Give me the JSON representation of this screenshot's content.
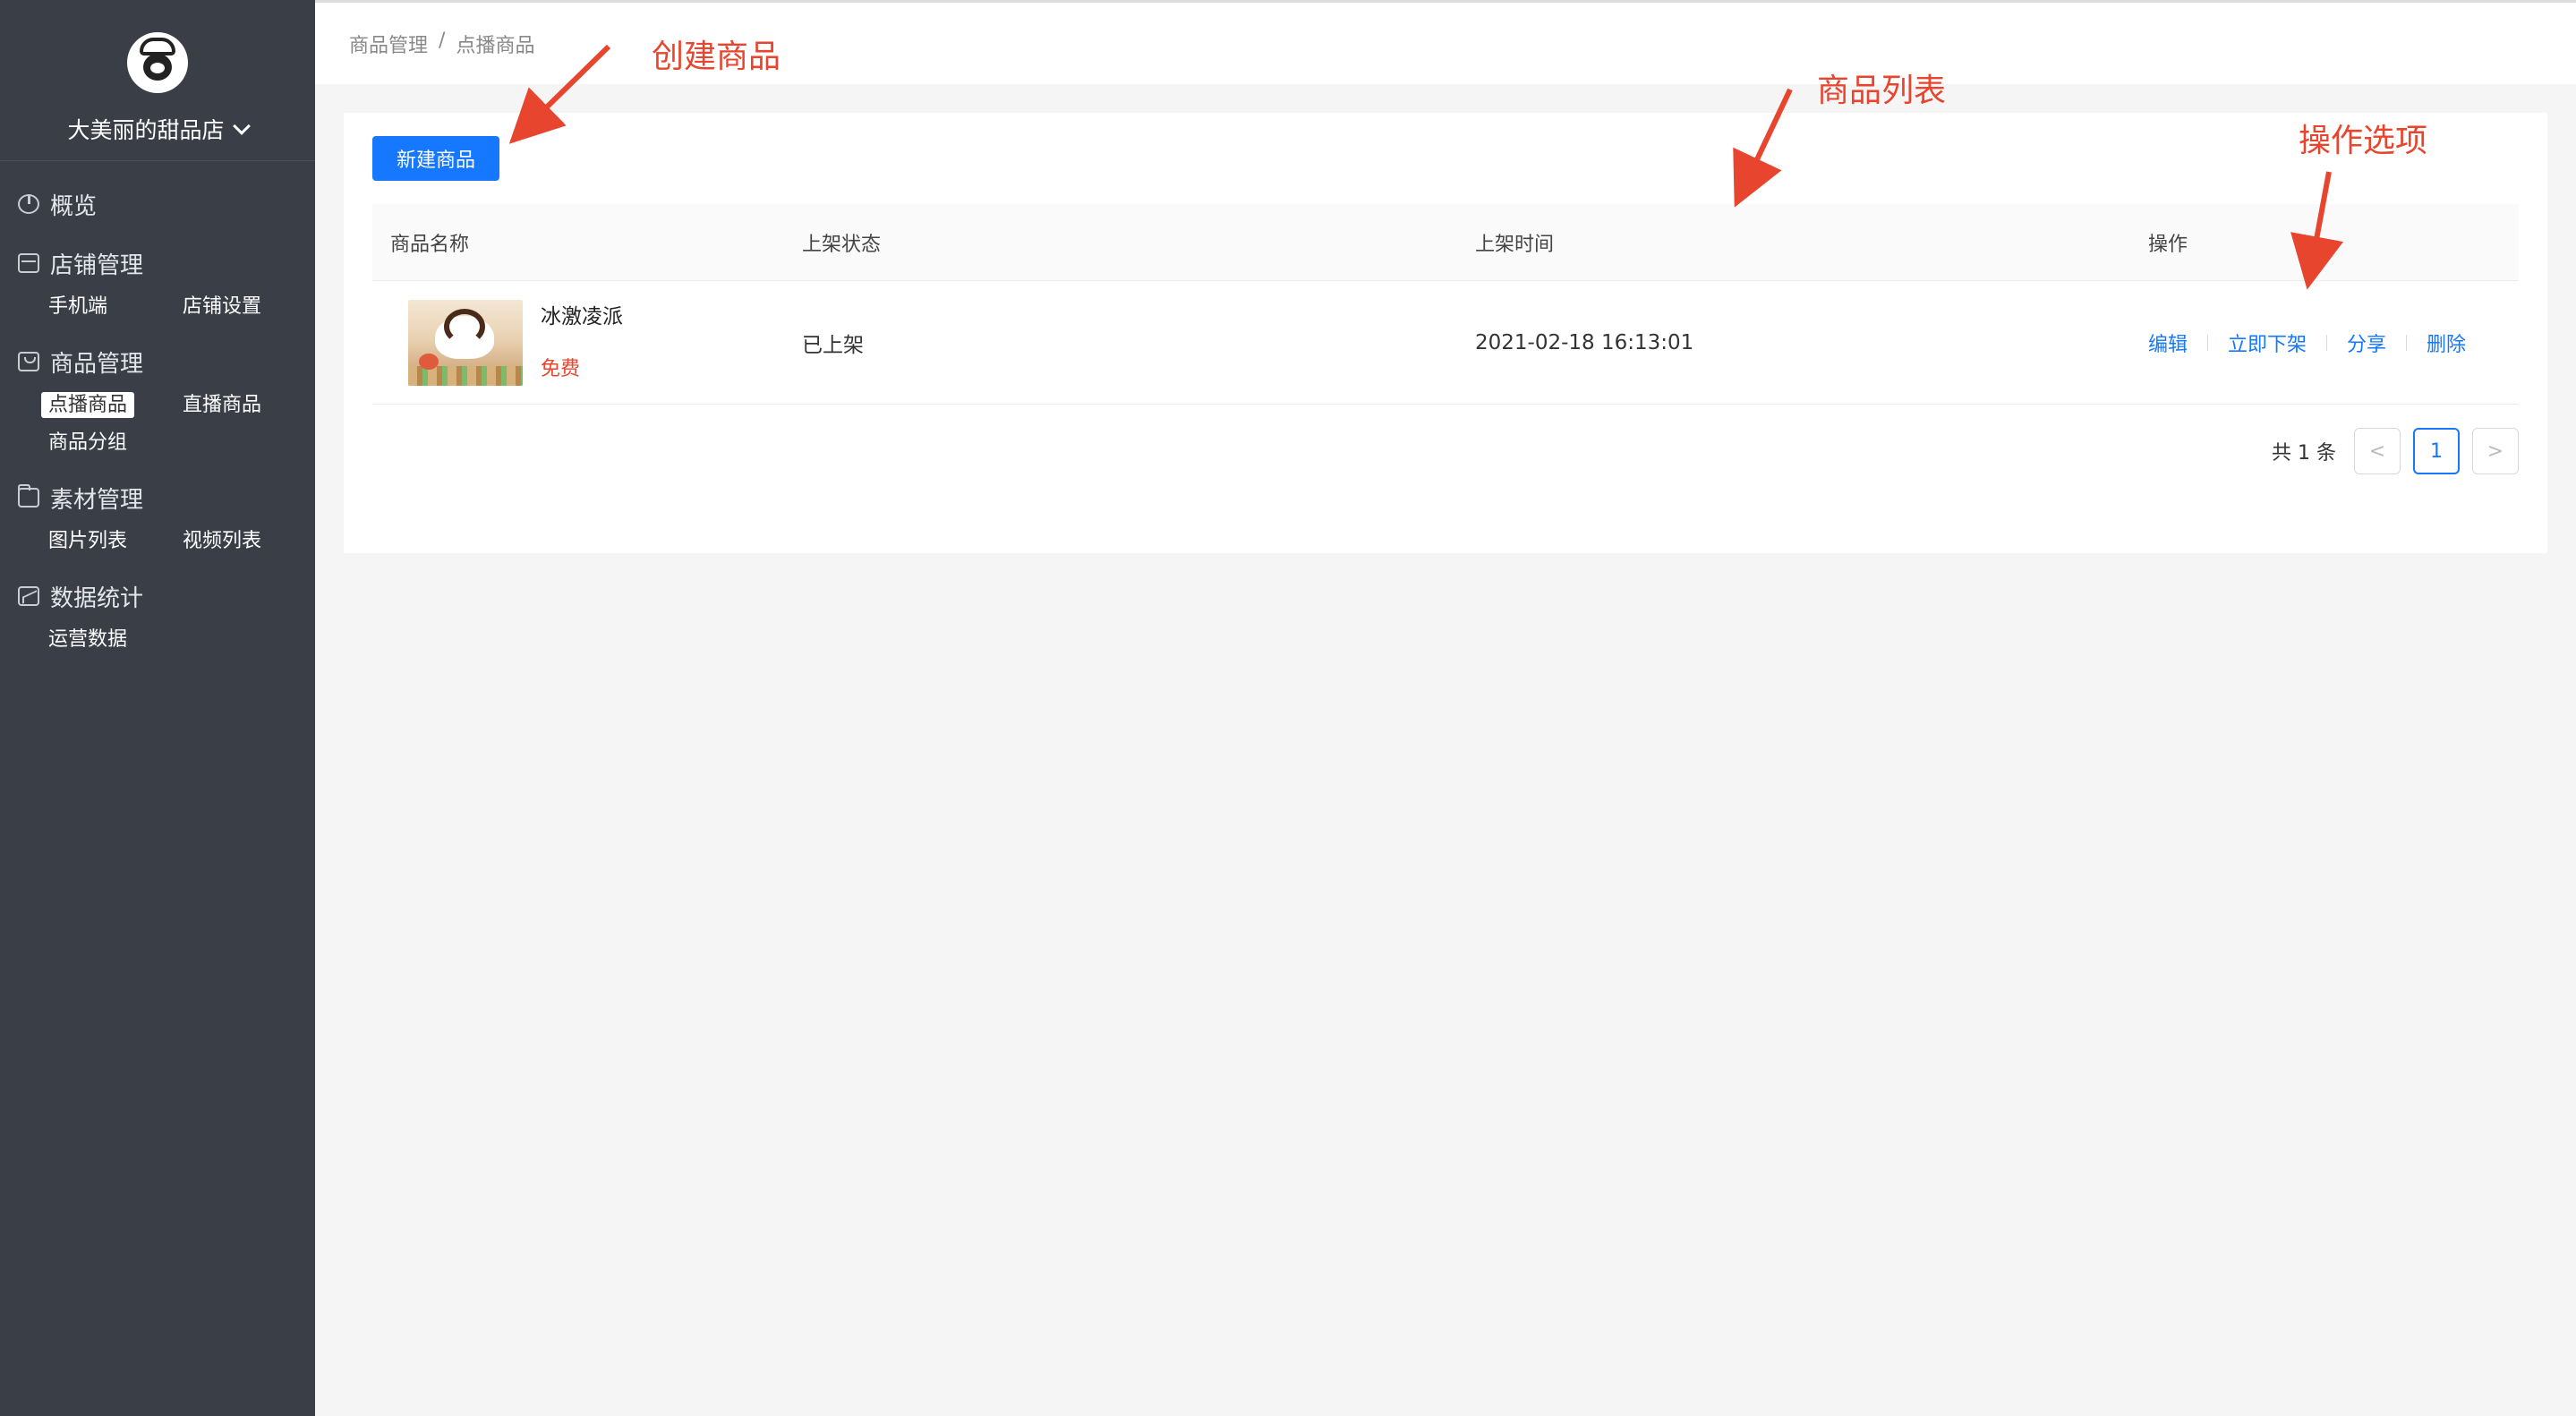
{
  "shop": {
    "name": "大美丽的甜品店"
  },
  "menu": {
    "overview": "概览",
    "store": {
      "title": "店铺管理",
      "items": [
        "手机端",
        "店铺设置"
      ]
    },
    "products": {
      "title": "商品管理",
      "items": [
        "点播商品",
        "直播商品",
        "商品分组"
      ]
    },
    "materials": {
      "title": "素材管理",
      "items": [
        "图片列表",
        "视频列表"
      ]
    },
    "stats": {
      "title": "数据统计",
      "items": [
        "运营数据"
      ]
    }
  },
  "breadcrumb": {
    "parent": "商品管理",
    "sep": "/",
    "current": "点播商品"
  },
  "toolbar": {
    "new_label": "新建商品"
  },
  "table": {
    "columns": [
      "商品名称",
      "上架状态",
      "上架时间",
      "操作"
    ],
    "rows": [
      {
        "name": "冰激凌派",
        "price": "免费",
        "status": "已上架",
        "time": "2021-02-18 16:13:01",
        "ops": [
          "编辑",
          "立即下架",
          "分享",
          "删除"
        ]
      }
    ]
  },
  "pagination": {
    "total": "共 1 条",
    "current": "1",
    "prev": "<",
    "next": ">"
  },
  "annotations": {
    "create": "创建商品",
    "list": "商品列表",
    "ops": "操作选项"
  },
  "colors": {
    "sidebar": "#3a3e47",
    "primary": "#1677ff",
    "annotation": "#e8452f",
    "price": "#e8452f"
  }
}
